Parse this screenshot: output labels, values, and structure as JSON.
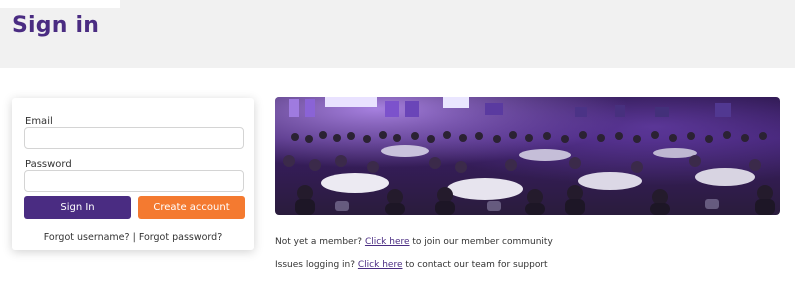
{
  "page": {
    "title": "Sign in"
  },
  "login": {
    "email_label": "Email",
    "email_value": "",
    "password_label": "Password",
    "password_value": "",
    "signin_label": "Sign In",
    "create_label": "Create account",
    "forgot_username": "Forgot username?",
    "separator": "|",
    "forgot_password": "Forgot password?"
  },
  "photo": {
    "icon": "conference-audience-photo"
  },
  "info": {
    "member_prefix": "Not yet a member?",
    "member_link": "Click here",
    "member_suffix": "to join our member community",
    "issues_prefix": "Issues logging in?",
    "issues_link": "Click here",
    "issues_suffix": "to contact our team for support"
  },
  "colors": {
    "brand_purple": "#4a2c82",
    "accent_orange": "#f47a30",
    "header_bg": "#f1f1f1"
  }
}
